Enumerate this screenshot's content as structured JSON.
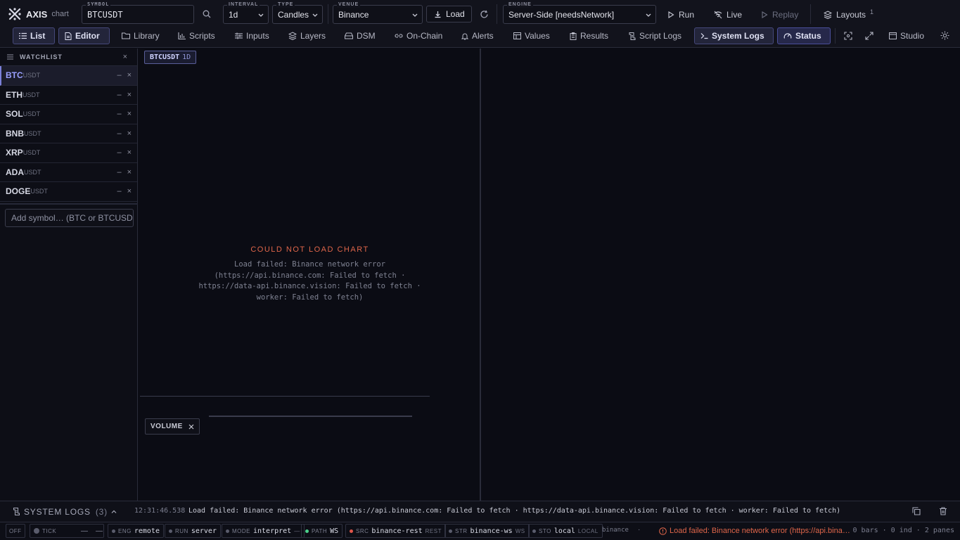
{
  "brand": {
    "name": "AXIS",
    "sub": "chart"
  },
  "topbar": {
    "symbol_label": "SYMBOL",
    "symbol_value": "BTCUSDT",
    "interval_label": "INTERVAL",
    "interval_value": "1d",
    "type_label": "TYPE",
    "type_value": "Candles",
    "venue_label": "VENUE",
    "venue_value": "Binance",
    "load_label": "Load",
    "engine_label": "ENGINE",
    "engine_value": "Server-Side [needsNetwork]",
    "run_label": "Run",
    "live_label": "Live",
    "replay_label": "Replay",
    "layouts_label": "Layouts",
    "layouts_count": "1"
  },
  "nav": {
    "items": [
      {
        "label": "List"
      },
      {
        "label": "Editor"
      },
      {
        "label": "Library"
      },
      {
        "label": "Scripts"
      },
      {
        "label": "Inputs"
      },
      {
        "label": "Layers"
      },
      {
        "label": "DSM"
      },
      {
        "label": "On-Chain"
      },
      {
        "label": "Alerts"
      },
      {
        "label": "Values"
      },
      {
        "label": "Results"
      },
      {
        "label": "Script Logs"
      },
      {
        "label": "System Logs"
      },
      {
        "label": "Status"
      }
    ],
    "studio_label": "Studio"
  },
  "watchlist": {
    "title": "WATCHLIST",
    "items": [
      {
        "base": "BTC",
        "quote": "USDT"
      },
      {
        "base": "ETH",
        "quote": "USDT"
      },
      {
        "base": "SOL",
        "quote": "USDT"
      },
      {
        "base": "BNB",
        "quote": "USDT"
      },
      {
        "base": "XRP",
        "quote": "USDT"
      },
      {
        "base": "ADA",
        "quote": "USDT"
      },
      {
        "base": "DOGE",
        "quote": "USDT"
      }
    ],
    "add_placeholder": "Add symbol… (BTC or BTCUSDT)"
  },
  "chart": {
    "symbol": "BTCUSDT",
    "interval": "1D",
    "error_title": "COULD NOT LOAD CHART",
    "error_message": "Load failed: Binance network error (https://api.binance.com: Failed to fetch · https://data-api.binance.vision: Failed to fetch · worker: Failed to fetch)",
    "volume_label": "VOLUME"
  },
  "syslogs": {
    "title": "SYSTEM LOGS",
    "count": "(3)",
    "time": "12:31:46.538",
    "message": "Load failed: Binance network error (https://api.binance.com: Failed to fetch · https://data-api.binance.vision: Failed to fetch · worker: Failed to fetch)"
  },
  "status": {
    "off": "OFF",
    "tick_label": "TICK",
    "tick_value": "—",
    "tick_value2": "—",
    "eng_key": "ENG",
    "eng_value": "remote",
    "run_key": "RUN",
    "run_value": "server",
    "mode_key": "MODE",
    "mode_value": "interpret",
    "mode_tag": "—",
    "path_key": "PATH",
    "path_value": "WS",
    "src_key": "SRC",
    "src_value": "binance-rest",
    "src_tag": "REST",
    "str_key": "STR",
    "str_value": "binance-ws",
    "str_tag": "WS",
    "sto_key": "STO",
    "sto_value": "local",
    "sto_tag": "LOCAL",
    "venue": "binance",
    "sep": "·",
    "error": "Load failed: Binance network error (https://api.binance.com: Failed to fetch)",
    "summary": "0 bars · 0 ind · 2 panes"
  },
  "colors": {
    "accent": "#7b80d8",
    "error": "#e0664a",
    "ok": "#4bd08a",
    "bg": "#0b0c14"
  }
}
